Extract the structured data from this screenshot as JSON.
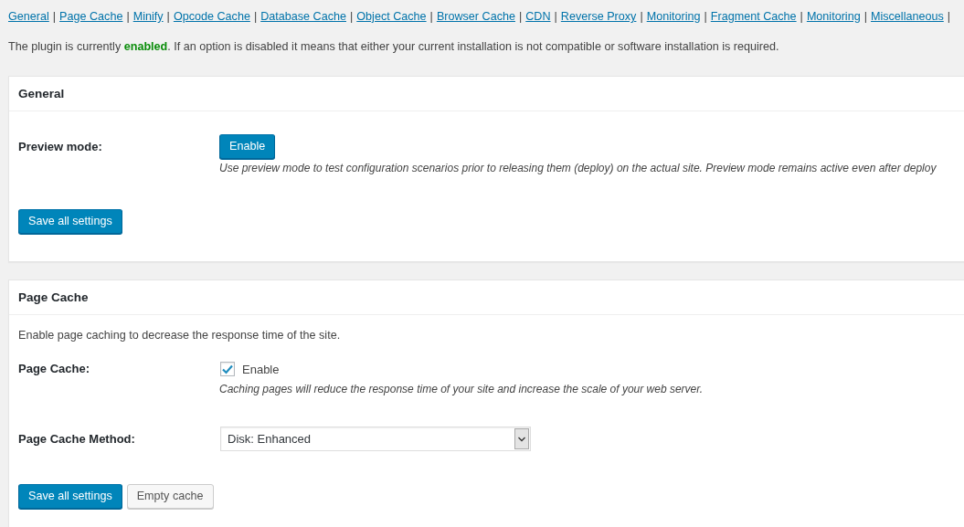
{
  "nav": {
    "separator": "|",
    "links": [
      {
        "label": "General"
      },
      {
        "label": "Page Cache"
      },
      {
        "label": "Minify"
      },
      {
        "label": "Opcode Cache"
      },
      {
        "label": "Database Cache"
      },
      {
        "label": "Object Cache"
      },
      {
        "label": "Browser Cache"
      },
      {
        "label": "CDN"
      },
      {
        "label": "Reverse Proxy"
      },
      {
        "label": "Monitoring"
      },
      {
        "label": "Fragment Cache"
      },
      {
        "label": "Monitoring"
      },
      {
        "label": "Miscellaneous"
      }
    ]
  },
  "notice": {
    "text": "The plugin is currently **enabled**. If an option is disabled it means that either your current installation is not compatible or software installation is required."
  },
  "sections": [
    {
      "title": "General",
      "fields": [
        {
          "kind": "button",
          "label": "Preview mode:",
          "button": "Enable",
          "description": "Use preview mode to test configuration scenarios prior to releasing them (deploy) on the actual site. Preview mode remains active even after deploy"
        }
      ],
      "buttons": [
        {
          "label": "Save all settings",
          "kind": "primary"
        }
      ]
    },
    {
      "title": "Page Cache",
      "intro": "Enable page caching to decrease the response time of the site.",
      "fields": [
        {
          "kind": "checkbox",
          "label": "Page Cache:",
          "checked": true,
          "option": "Enable",
          "description": "Caching pages will reduce the response time of your site and increase the scale of your web server."
        },
        {
          "kind": "select",
          "label": "Page Cache Method:",
          "value": "Disk: Enhanced"
        }
      ],
      "buttons": [
        {
          "label": "Save all settings",
          "kind": "primary"
        },
        {
          "label": "Empty cache",
          "kind": "secondary"
        }
      ]
    }
  ]
}
